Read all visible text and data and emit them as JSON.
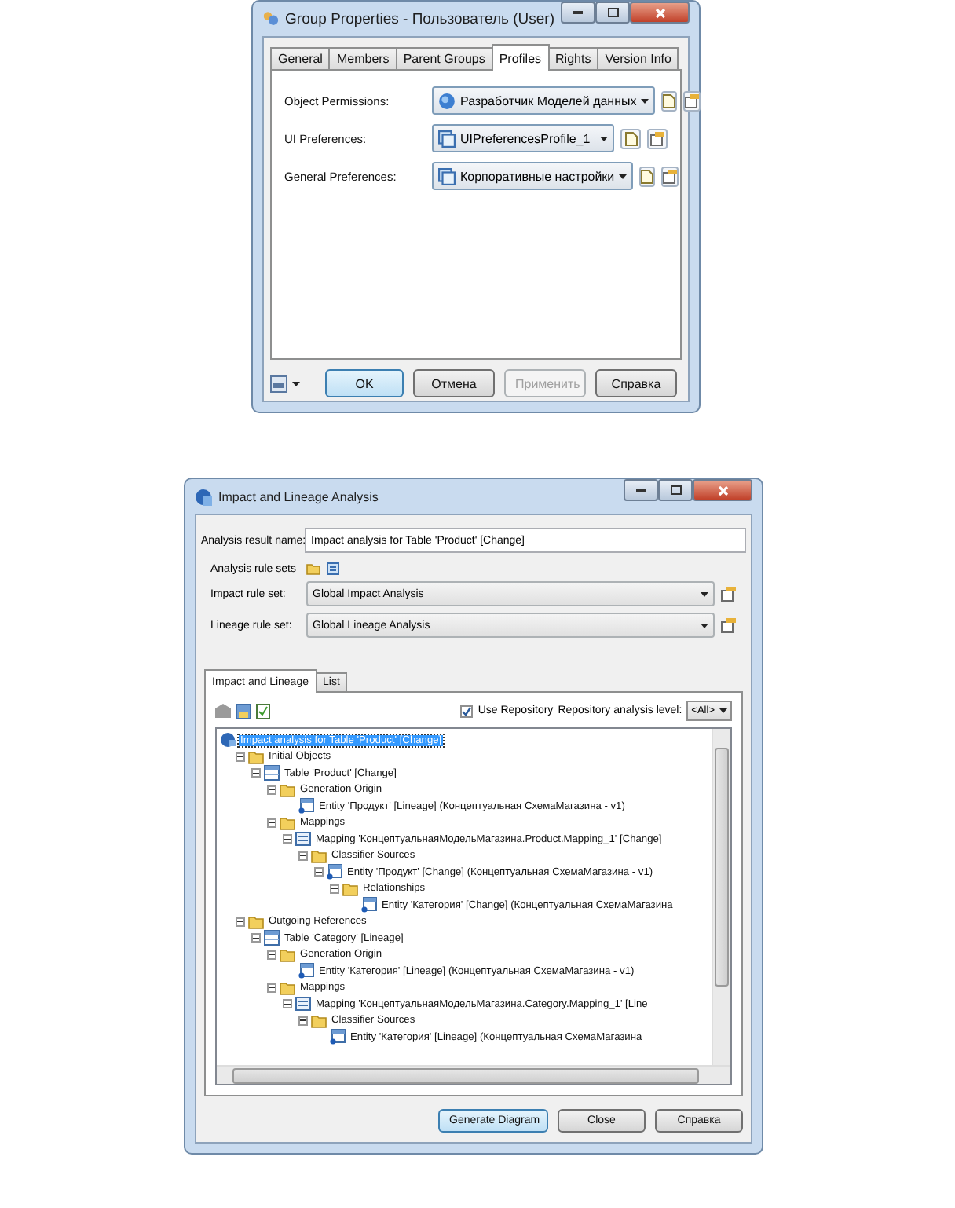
{
  "group_properties": {
    "title": "Group Properties - Пользователь (User)",
    "tabs": [
      {
        "label": "General",
        "selected": false
      },
      {
        "label": "Members",
        "selected": false
      },
      {
        "label": "Parent Groups",
        "selected": false
      },
      {
        "label": "Profiles",
        "selected": true
      },
      {
        "label": "Rights",
        "selected": false
      },
      {
        "label": "Version Info",
        "selected": false
      }
    ],
    "fields": [
      {
        "label": "Object Permissions:",
        "value": "Разработчик Моделей данных",
        "kind": "role"
      },
      {
        "label": "UI Preferences:",
        "value": "UIPreferencesProfile_1",
        "kind": "preferences"
      },
      {
        "label": "General Preferences:",
        "value": "Корпоративные настройки",
        "kind": "preferences"
      }
    ],
    "buttons": [
      {
        "label": "OK",
        "kind": "default",
        "disabled": false
      },
      {
        "label": "Отмена",
        "kind": "normal",
        "disabled": false
      },
      {
        "label": "Применить",
        "kind": "normal",
        "disabled": true
      },
      {
        "label": "Справка",
        "kind": "normal",
        "disabled": false
      }
    ]
  },
  "impact_analysis": {
    "title": "Impact and Lineage Analysis",
    "result_name": {
      "label": "Analysis result name:",
      "value": "Impact analysis for Table 'Product' [Change]"
    },
    "rule_sets_label": "Analysis rule sets",
    "rule_sets": [
      {
        "label": "Impact rule set:",
        "value": "Global Impact Analysis"
      },
      {
        "label": "Lineage rule set:",
        "value": "Global Lineage Analysis"
      }
    ],
    "tabs": [
      {
        "label": "Impact and Lineage",
        "selected": true
      },
      {
        "label": "List",
        "selected": false
      }
    ],
    "use_repository": {
      "label": "Use Repository",
      "checked": true
    },
    "analysis_level": {
      "label": "Repository analysis level:",
      "value": "<All>"
    },
    "tree": {
      "label": "Impact analysis for Table 'Product' [Change]",
      "kind": "root",
      "selected": true,
      "children": [
        {
          "label": "Initial Objects",
          "kind": "folder",
          "selected": false,
          "expanded": true,
          "children": [
            {
              "label": "Table 'Product' [Change]",
              "kind": "table",
              "selected": false,
              "expanded": true,
              "children": [
                {
                  "label": "Generation Origin",
                  "kind": "folder",
                  "selected": false,
                  "expanded": true,
                  "children": [
                    {
                      "label": "Entity 'Продукт' [Lineage] (Концептуальная СхемаМагазина - v1)",
                      "kind": "entity",
                      "selected": false
                    }
                  ]
                },
                {
                  "label": "Mappings",
                  "kind": "folder",
                  "selected": false,
                  "expanded": true,
                  "children": [
                    {
                      "label": "Mapping 'КонцептуальнаяМодельМагазина.Product.Mapping_1' [Change]",
                      "kind": "mapping",
                      "selected": false,
                      "expanded": true,
                      "children": [
                        {
                          "label": "Classifier Sources",
                          "kind": "folder",
                          "selected": false,
                          "expanded": true,
                          "children": [
                            {
                              "label": "Entity 'Продукт' [Change] (Концептуальная СхемаМагазина - v1)",
                              "kind": "entity",
                              "selected": false,
                              "expanded": true,
                              "children": [
                                {
                                  "label": "Relationships",
                                  "kind": "folder",
                                  "selected": false,
                                  "expanded": true,
                                  "children": [
                                    {
                                      "label": "Entity 'Категория' [Change] (Концептуальная СхемаМагазина",
                                      "kind": "entity",
                                      "selected": false
                                    }
                                  ]
                                }
                              ]
                            }
                          ]
                        }
                      ]
                    }
                  ]
                }
              ]
            }
          ]
        },
        {
          "label": "Outgoing References",
          "kind": "folder",
          "selected": false,
          "expanded": true,
          "children": [
            {
              "label": "Table 'Category' [Lineage]",
              "kind": "table",
              "selected": false,
              "expanded": true,
              "children": [
                {
                  "label": "Generation Origin",
                  "kind": "folder",
                  "selected": false,
                  "expanded": true,
                  "children": [
                    {
                      "label": "Entity 'Категория' [Lineage] (Концептуальная СхемаМагазина - v1)",
                      "kind": "entity",
                      "selected": false
                    }
                  ]
                },
                {
                  "label": "Mappings",
                  "kind": "folder",
                  "selected": false,
                  "expanded": true,
                  "children": [
                    {
                      "label": "Mapping 'КонцептуальнаяМодельМагазина.Category.Mapping_1' [Line",
                      "kind": "mapping",
                      "selected": false,
                      "expanded": true,
                      "children": [
                        {
                          "label": "Classifier Sources",
                          "kind": "folder",
                          "selected": false,
                          "expanded": true,
                          "children": [
                            {
                              "label": "Entity 'Категория' [Lineage] (Концептуальная СхемаМагазина",
                              "kind": "entity",
                              "selected": false
                            }
                          ]
                        }
                      ]
                    }
                  ]
                }
              ]
            }
          ]
        }
      ]
    },
    "buttons": [
      {
        "label": "Generate Diagram",
        "kind": "default",
        "disabled": false
      },
      {
        "label": "Close",
        "kind": "normal",
        "disabled": false
      },
      {
        "label": "Справка",
        "kind": "normal",
        "disabled": false
      }
    ]
  }
}
